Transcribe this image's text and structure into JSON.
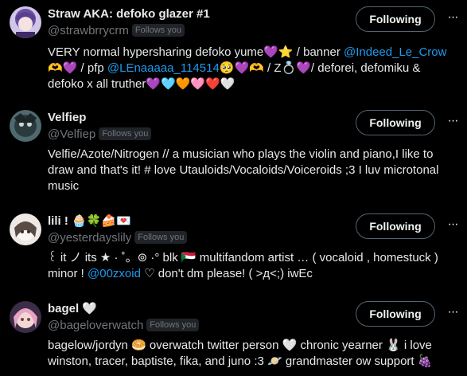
{
  "users": [
    {
      "name": "Straw AKA: defoko glazer #1",
      "handle": "@strawbrrycrm",
      "follows_badge": "Follows you",
      "follow_label": "Following",
      "more_label": "···",
      "bio_parts": [
        {
          "t": "text",
          "v": "VERY normal hypersharing defoko yume💜⭐ / banner "
        },
        {
          "t": "mention",
          "v": "@Indeed_Le_Crow"
        },
        {
          "t": "text",
          "v": " 🫶💜 / pfp "
        },
        {
          "t": "mention",
          "v": "@LEnaaaaa_114514"
        },
        {
          "t": "text",
          "v": "🥺💜🫶 / Z💍💜/ deforei, defomiku & defoko x all truther💜🩵🧡🩷❤️🤍"
        }
      ]
    },
    {
      "name": "Velfiep",
      "handle": "@Velfiep",
      "follows_badge": "Follows you",
      "follow_label": "Following",
      "more_label": "···",
      "bio_parts": [
        {
          "t": "text",
          "v": "Velfie/Azote/Nitrogen // a musician who plays the violin and piano,I like to draw and that's it! # love Utauloids/Vocaloids/Voiceroids ;3 I luv microtonal music"
        }
      ]
    },
    {
      "name": "lili ! 🧁🍀🍰💌",
      "handle": "@yesterdayslily",
      "follows_badge": "Follows you",
      "follow_label": "Following",
      "more_label": "···",
      "bio_parts": [
        {
          "t": "text",
          "v": "꒰ it ノ its ★ · ˚。⊚ ·° blk 🇸🇩 multifandom artist … ( vocaloid , homestuck ) minor ! "
        },
        {
          "t": "mention",
          "v": "@00zxoid"
        },
        {
          "t": "text",
          "v": " ♡ don't dm please! ( >д<;) iwEc"
        }
      ]
    },
    {
      "name": "bagel 🤍",
      "handle": "@bageloverwatch",
      "follows_badge": "Follows you",
      "follow_label": "Following",
      "more_label": "···",
      "bio_parts": [
        {
          "t": "text",
          "v": "bagelow/jordyn 🥯 overwatch twitter person 🤍 chronic yearner 🐰 i love winston, tracer, baptiste, fika, and juno :3 🪐 grandmaster ow support 🍇"
        }
      ]
    }
  ],
  "colors": {
    "background": "#000000",
    "primary_text": "#e7e9ea",
    "secondary_text": "#71767b",
    "mention": "#1d9bf0",
    "badge_bg": "#202327",
    "button_border": "#536471"
  }
}
